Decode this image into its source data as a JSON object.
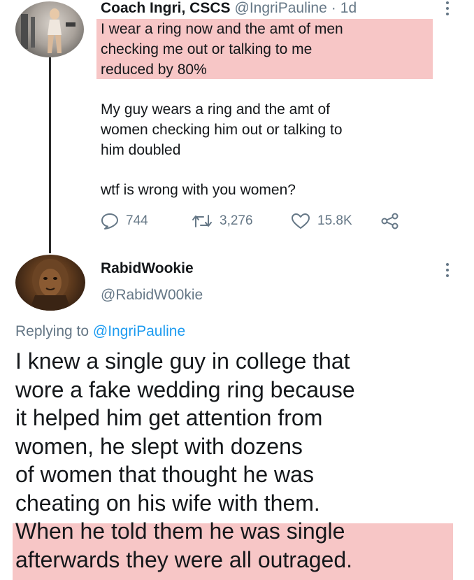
{
  "tweet1": {
    "display_name": "Coach Ingri, CSCS",
    "handle": "@IngriPauline",
    "separator": "·",
    "time": "1d",
    "paragraph1_lines": [
      "I wear a ring now and the amt of men",
      "checking me out or talking to me",
      "reduced by 80%"
    ],
    "paragraph2_lines": [
      "My guy wears a ring and the amt of",
      "women checking him out or talking to",
      "him doubled"
    ],
    "paragraph3": "wtf is wrong with you women?",
    "replies": "744",
    "retweets": "3,276",
    "likes": "15.8K",
    "highlight_color": "#f7c6c6"
  },
  "tweet2": {
    "display_name": "RabidWookie",
    "handle": "@RabidW00kie",
    "replying_prefix": "Replying to",
    "replying_mention": "@IngriPauline",
    "body_lines": [
      "I knew a single guy in college that",
      "wore a fake wedding ring because",
      "it helped him get attention from",
      "women, he slept with dozens",
      "of women that thought he was",
      "cheating on his wife with them.",
      "When he told them he was single",
      "afterwards they were all outraged."
    ]
  },
  "icons": {
    "reply": "reply-icon",
    "retweet": "retweet-icon",
    "like": "heart-icon",
    "share": "share-icon",
    "more": "more-vertical-icon"
  },
  "colors": {
    "text": "#14171a",
    "secondary": "#657786",
    "link": "#1d9bf0",
    "highlight": "#f7c6c6"
  }
}
